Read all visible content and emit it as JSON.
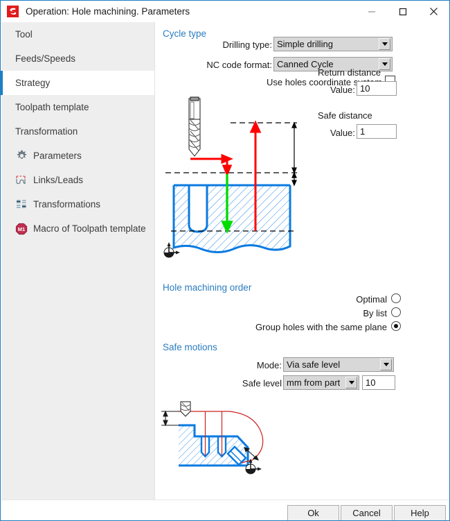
{
  "window": {
    "title": "Operation: Hole machining. Parameters",
    "app_icon": "app-logo-icon",
    "controls": {
      "minimize": "minimize-icon",
      "maximize": "maximize-icon",
      "close": "close-icon"
    },
    "accent_color": "#1d7fc4"
  },
  "sidebar": {
    "items": [
      {
        "label": "Tool",
        "icon": null,
        "selected": false
      },
      {
        "label": "Feeds/Speeds",
        "icon": null,
        "selected": false
      },
      {
        "label": "Strategy",
        "icon": null,
        "selected": true
      },
      {
        "label": "Toolpath template",
        "icon": null,
        "selected": false
      },
      {
        "label": "Transformation",
        "icon": null,
        "selected": false
      },
      {
        "label": "Parameters",
        "icon": "gear-icon",
        "selected": false
      },
      {
        "label": "Links/Leads",
        "icon": "links-leads-icon",
        "selected": false
      },
      {
        "label": "Transformations",
        "icon": "transformations-icon",
        "selected": false
      },
      {
        "label": "Macro of Toolpath template",
        "icon": "macro-m1-icon",
        "selected": false
      }
    ]
  },
  "main": {
    "section_cycle_type": "Cycle type",
    "drilling_type_label": "Drilling type:",
    "drilling_type_value": "Simple drilling",
    "nc_code_format_label": "NC code format:",
    "nc_code_format_value": "Canned Cycle",
    "use_holes_cs_label": "Use holes coordinate system",
    "use_holes_cs_checked": false,
    "return_distance_label": "Return distance",
    "return_distance_value_label": "Value:",
    "return_distance_value": "10",
    "safe_distance_label": "Safe distance",
    "safe_distance_value_label": "Value:",
    "safe_distance_value": "1",
    "section_hole_order": "Hole machining order",
    "order_options": [
      {
        "label": "Optimal",
        "selected": false
      },
      {
        "label": "By list",
        "selected": false
      },
      {
        "label": "Group holes with the same plane",
        "selected": true
      }
    ],
    "section_safe_motions": "Safe motions",
    "mode_label": "Mode:",
    "mode_value": "Via safe level",
    "safe_level_label": "Safe level",
    "safe_level_unit_value": "mm from part",
    "safe_level_value": "10",
    "diagram_top": "drilling-cycle-diagram",
    "diagram_bottom": "safe-level-diagram",
    "diagram_colors": {
      "part_outline": "#0a7ae0",
      "hatch": "#2b8ae8",
      "rapid_move": "#ff0000",
      "feed_move": "#00dd00",
      "reference_line": "#000000"
    }
  },
  "footer": {
    "buttons": [
      {
        "label": "Ok",
        "name": "ok-button"
      },
      {
        "label": "Cancel",
        "name": "cancel-button"
      },
      {
        "label": "Help",
        "name": "help-button"
      }
    ]
  }
}
